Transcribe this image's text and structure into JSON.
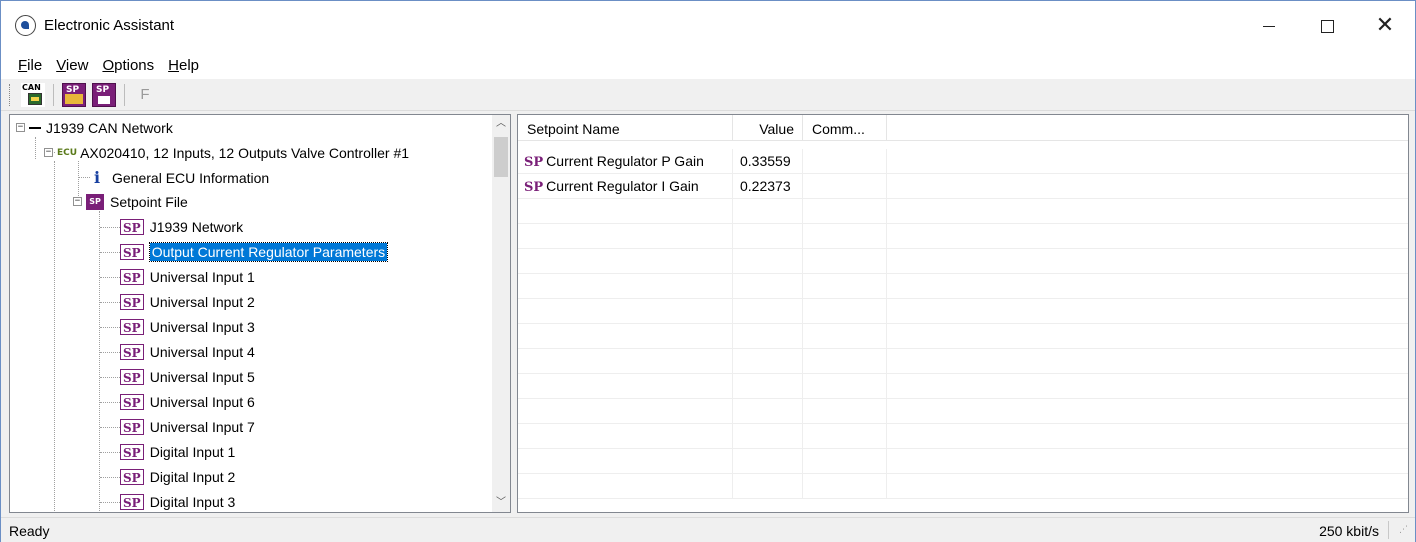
{
  "window": {
    "title": "Electronic Assistant",
    "icon": "app-logo-icon"
  },
  "menu": [
    {
      "label": "File",
      "underline": "F",
      "rest": "ile"
    },
    {
      "label": "View",
      "underline": "V",
      "rest": "iew"
    },
    {
      "label": "Options",
      "underline": "O",
      "rest": "ptions"
    },
    {
      "label": "Help",
      "underline": "H",
      "rest": "elp"
    }
  ],
  "toolbar": {
    "can_label": "CAN",
    "sp_label": "SP",
    "f_label": "F"
  },
  "tree": {
    "network": "J1939 CAN Network",
    "ecu_tag": "ECU",
    "ecu": "AX020410, 12 Inputs, 12 Outputs Valve Controller #1",
    "info_glyph": "i",
    "general": "General ECU Information",
    "setpoint_file": "Setpoint File",
    "sp_glyph": "SP",
    "items": [
      "J1939 Network",
      "Output Current Regulator Parameters",
      "Universal Input 1",
      "Universal Input 2",
      "Universal Input 3",
      "Universal Input 4",
      "Universal Input 5",
      "Universal Input 6",
      "Universal Input 7",
      "Digital Input 1",
      "Digital Input 2",
      "Digital Input 3"
    ],
    "selected_index": 1
  },
  "list": {
    "columns": {
      "name": "Setpoint Name",
      "value": "Value",
      "comment": "Comm..."
    },
    "rows": [
      {
        "glyph": "SP",
        "name": "Current Regulator P Gain",
        "value": "0.33559",
        "comment": ""
      },
      {
        "glyph": "SP",
        "name": "Current Regulator I Gain",
        "value": "0.22373",
        "comment": ""
      }
    ]
  },
  "status": {
    "left": "Ready",
    "right": "250 kbit/s"
  },
  "colors": {
    "selection": "#0078d7",
    "setpoint": "#7a1f78",
    "border": "#828790"
  }
}
